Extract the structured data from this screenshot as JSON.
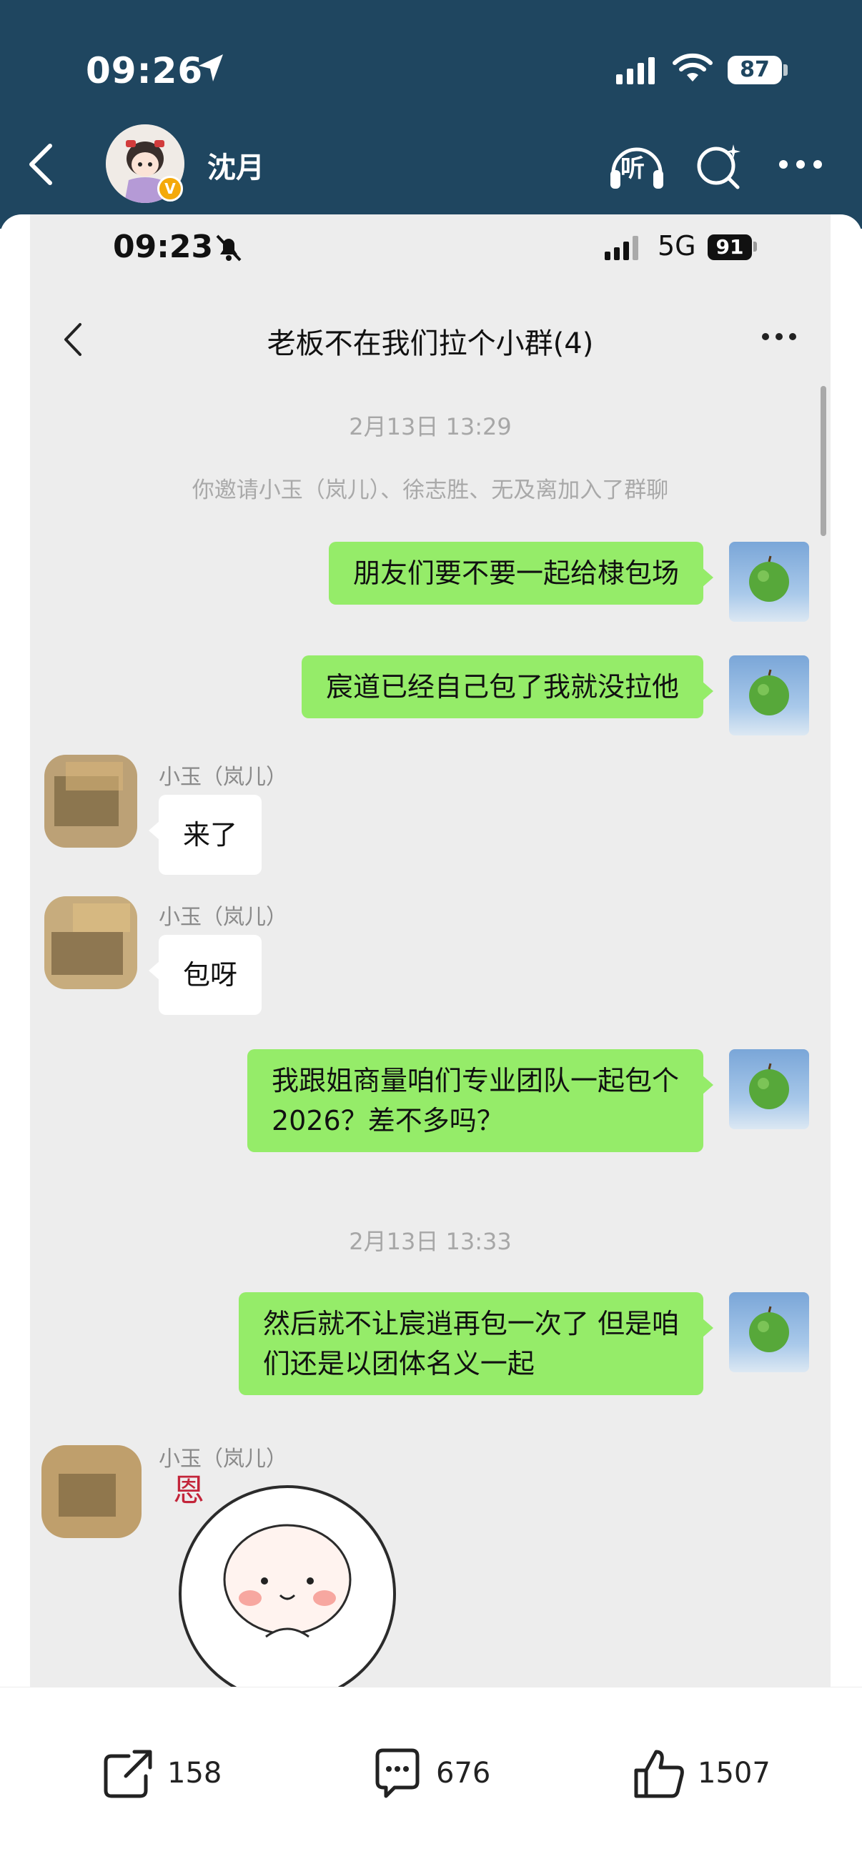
{
  "outer_status": {
    "time": "09:26",
    "battery": "87"
  },
  "outer_header": {
    "user_name": "沈月",
    "listen_label": "听",
    "verified_mark": "V"
  },
  "screenshot": {
    "status": {
      "time": "09:23",
      "network": "5G",
      "battery": "91"
    },
    "chat_title": "老板不在我们拉个小群(4)",
    "messages": [
      {
        "type": "timestamp",
        "text": "2月13日 13:29"
      },
      {
        "type": "system",
        "text": "你邀请小玉（岚儿）、徐志胜、无及离加入了群聊"
      },
      {
        "type": "me",
        "text": "朋友们要不要一起给棣包场"
      },
      {
        "type": "me",
        "text": "宸道已经自己包了我就没拉他"
      },
      {
        "type": "other",
        "sender": "小玉（岚儿）",
        "text": "来了"
      },
      {
        "type": "other",
        "sender": "小玉（岚儿）",
        "text": "包呀"
      },
      {
        "type": "me",
        "lines": [
          "我跟姐商量咱们专业团队一起包个",
          "2026？差不多吗？"
        ]
      },
      {
        "type": "timestamp",
        "text": "2月13日 13:33"
      },
      {
        "type": "me",
        "lines": [
          "然后就不让宸逍再包一次了 但是咱",
          "们还是以团体名义一起"
        ]
      },
      {
        "type": "other_sticker",
        "sender": "小玉（岚儿）",
        "sticker": "sheep-sticker-icon",
        "sticker_text": "恩"
      }
    ]
  },
  "actions": {
    "share_count": "158",
    "comment_count": "676",
    "like_count": "1507"
  },
  "colors": {
    "header_bg": "#1f4660",
    "chat_bg": "#ededed",
    "my_bubble": "#95ec69",
    "other_bubble": "#ffffff"
  }
}
